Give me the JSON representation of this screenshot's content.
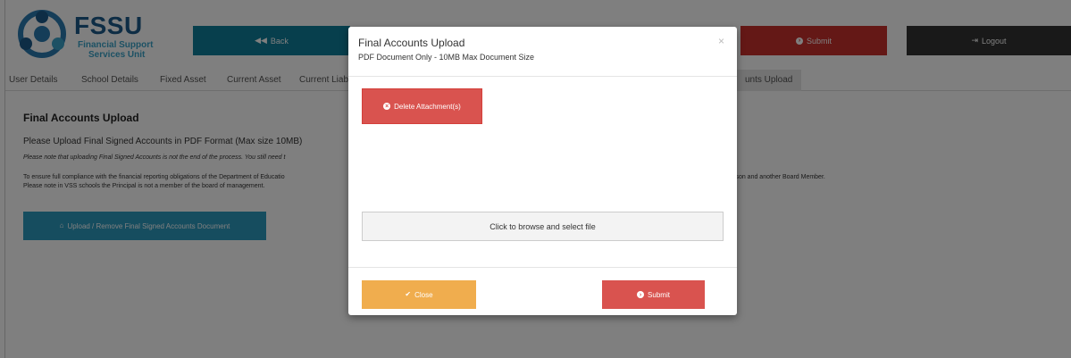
{
  "header": {
    "logo_title": "FSSU",
    "logo_line1": "Financial Support",
    "logo_line2": "Services Unit",
    "back_label": "Back",
    "submit_label": "Submit",
    "logout_label": "Logout"
  },
  "tabs": [
    {
      "label": "User Details"
    },
    {
      "label": "School Details"
    },
    {
      "label": "Fixed Asset"
    },
    {
      "label": "Current Asset"
    },
    {
      "label": "Current Liab"
    },
    {
      "label": "unts Upload"
    }
  ],
  "content": {
    "title": "Final Accounts Upload",
    "instruction": "Please Upload Final Signed Accounts in PDF Format (Max size 10MB)",
    "note": "Please note that uploading Final Signed Accounts is not the end of the process. You still need t",
    "compliance_left": "To ensure full compliance with the financial reporting obligations of the Department of Educatio",
    "compliance_right": "rperson and another Board Member.",
    "vss_note": "Please note in VSS schools the Principal is not a member of the board of management.",
    "upload_button": "Upload / Remove Final Signed Accounts Document"
  },
  "modal": {
    "title": "Final Accounts Upload",
    "subtitle": "PDF Document Only - 10MB Max Document Size",
    "close_x": "×",
    "delete_label": "Delete Attachment(s)",
    "browse_label": "Click to browse and select file",
    "close_label": "Close",
    "submit_label": "Submit"
  },
  "icons": {
    "back": "backward-icon",
    "submit": "circle-arrow-icon",
    "logout": "logout-icon",
    "upload": "home-icon",
    "delete": "remove-circle-icon",
    "close": "check-icon"
  },
  "colors": {
    "primary_teal": "#0e7e9a",
    "danger": "#d9534f",
    "warning": "#f0ad4e",
    "dark": "#333333",
    "info": "#2d9bbf"
  }
}
